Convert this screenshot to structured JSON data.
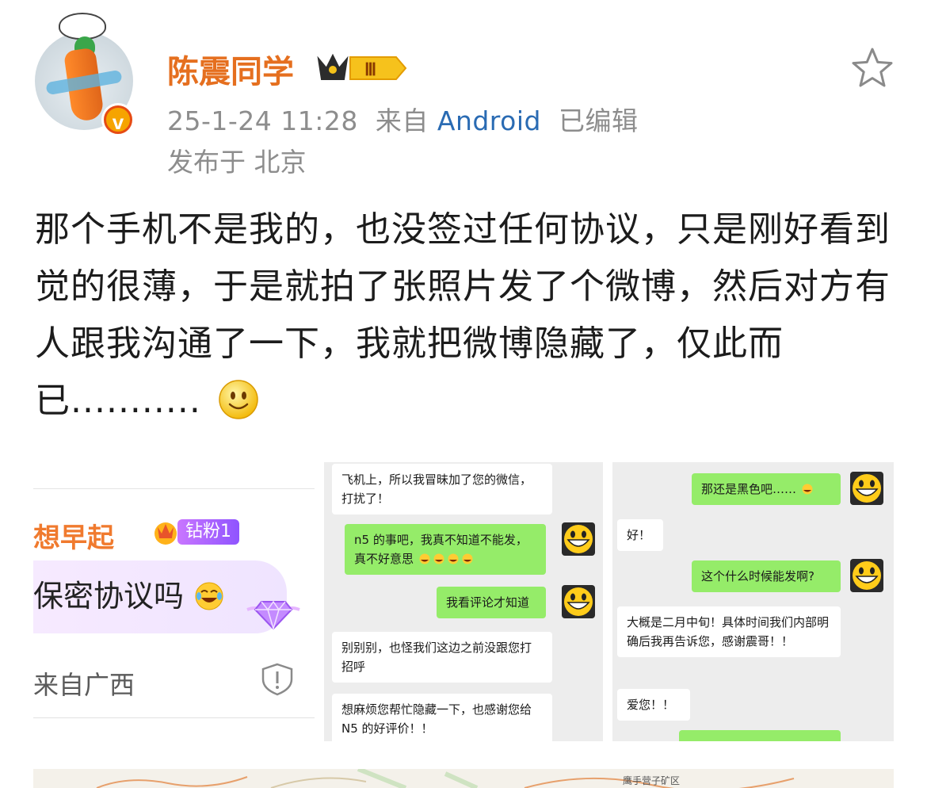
{
  "post": {
    "username": "陈震同学",
    "level_badge": "Ⅲ",
    "verified_badge": "v",
    "date": "25-1-24 11:28",
    "from_prefix": "来自",
    "source": "Android",
    "edited": "已编辑",
    "location": "发布于 北京",
    "body": "那个手机不是我的，也没签过任何协议，只是刚好看到觉的很薄，于是就拍了张照片发了个微博，然后对方有人跟我沟通了一下，我就把微博隐藏了，仅此而已..........."
  },
  "image1": {
    "username": "想早起",
    "fan_badge": "钻粉1",
    "comment": "保密协议吗",
    "from": "来自广西"
  },
  "image2": {
    "messages": [
      {
        "side": "left",
        "text": "飞机上，所以我冒昧加了您的微信，打扰了！"
      },
      {
        "side": "right",
        "text": "n5 的事吧，我真不知道不能发，真不好意思"
      },
      {
        "side": "right",
        "text": "我看评论才知道"
      },
      {
        "side": "left",
        "text": "别别别，也怪我们这边之前没跟您打招呼"
      },
      {
        "side": "left",
        "text": "想麻烦您帮忙隐藏一下，也感谢您给 N5 的好评价！！"
      }
    ]
  },
  "image3": {
    "messages": [
      {
        "side": "right",
        "text": "那还是黑色吧……"
      },
      {
        "side": "left",
        "text": "好！"
      },
      {
        "side": "right",
        "text": "这个什么时候能发啊?"
      },
      {
        "side": "left",
        "text": "大概是二月中旬！具体时间我们内部明确后我再告诉您，感谢震哥！！"
      },
      {
        "side": "left",
        "text": "爱您！！"
      }
    ]
  },
  "image4": {
    "map_label": "鹰手营子矿区"
  },
  "colors": {
    "username": "#e56f1f",
    "meta": "#8d8d8d",
    "source_link": "#2a6bb3",
    "wechat_green": "#95ec69",
    "chat_bg": "#ededed"
  },
  "icons": [
    "crown-level-icon",
    "star-favorite-icon",
    "smile-emoji-icon",
    "verified-v-icon",
    "laugh-cry-emoji-icon",
    "warning-icon",
    "gem-icon",
    "grin-avatar-icon"
  ]
}
